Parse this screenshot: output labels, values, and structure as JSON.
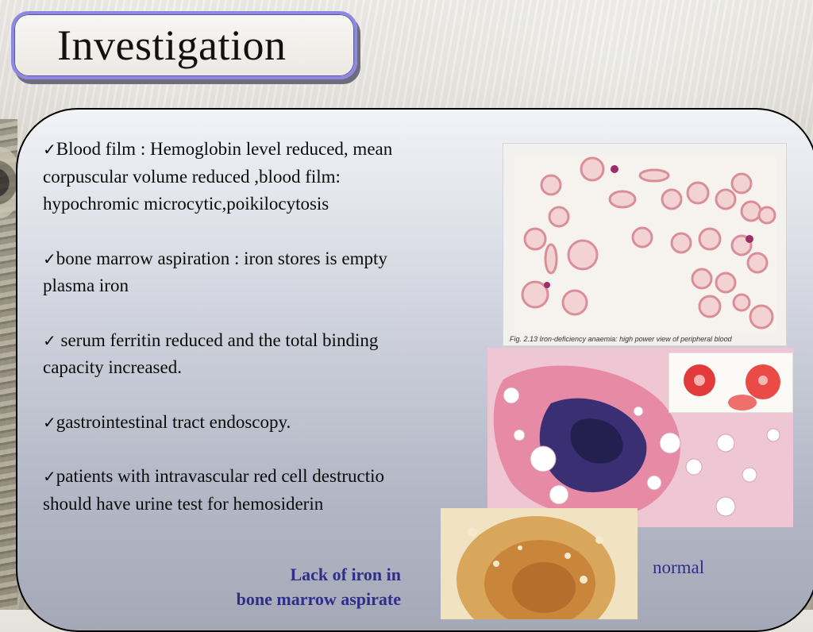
{
  "slide": {
    "title": "Investigation"
  },
  "bullets": [
    {
      "check": "✓",
      "text": "Blood film : Hemoglobin level reduced, mean\ncorpuscular volume reduced ,blood film:\nhypochromic microcytic,poikilocytosis"
    },
    {
      "check": "✓",
      "text": "bone marrow aspiration :  iron stores is empty\nplasma iron"
    },
    {
      "check": "✓",
      "text": " serum ferritin reduced and the total binding\ncapacity increased."
    },
    {
      "check": "✓",
      "text": "gastrointestinal tract endoscopy."
    },
    {
      "check": "✓",
      "text": "patients with intravascular red cell destructio\nshould have urine test for hemosiderin"
    }
  ],
  "figures": {
    "blood_film_caption": "Fig. 2.13  Iron-deficiency anaemia: high power view of peripheral blood",
    "lack_label_line1": "Lack of iron in",
    "lack_label_line2": "bone  marrow  aspirate",
    "normal_label": "normal"
  },
  "colors": {
    "title_border": "#8f88e2",
    "label_color": "#2f2f8a",
    "rbc": "#e9a9ae",
    "iron_stain": "#2a2a6e"
  }
}
